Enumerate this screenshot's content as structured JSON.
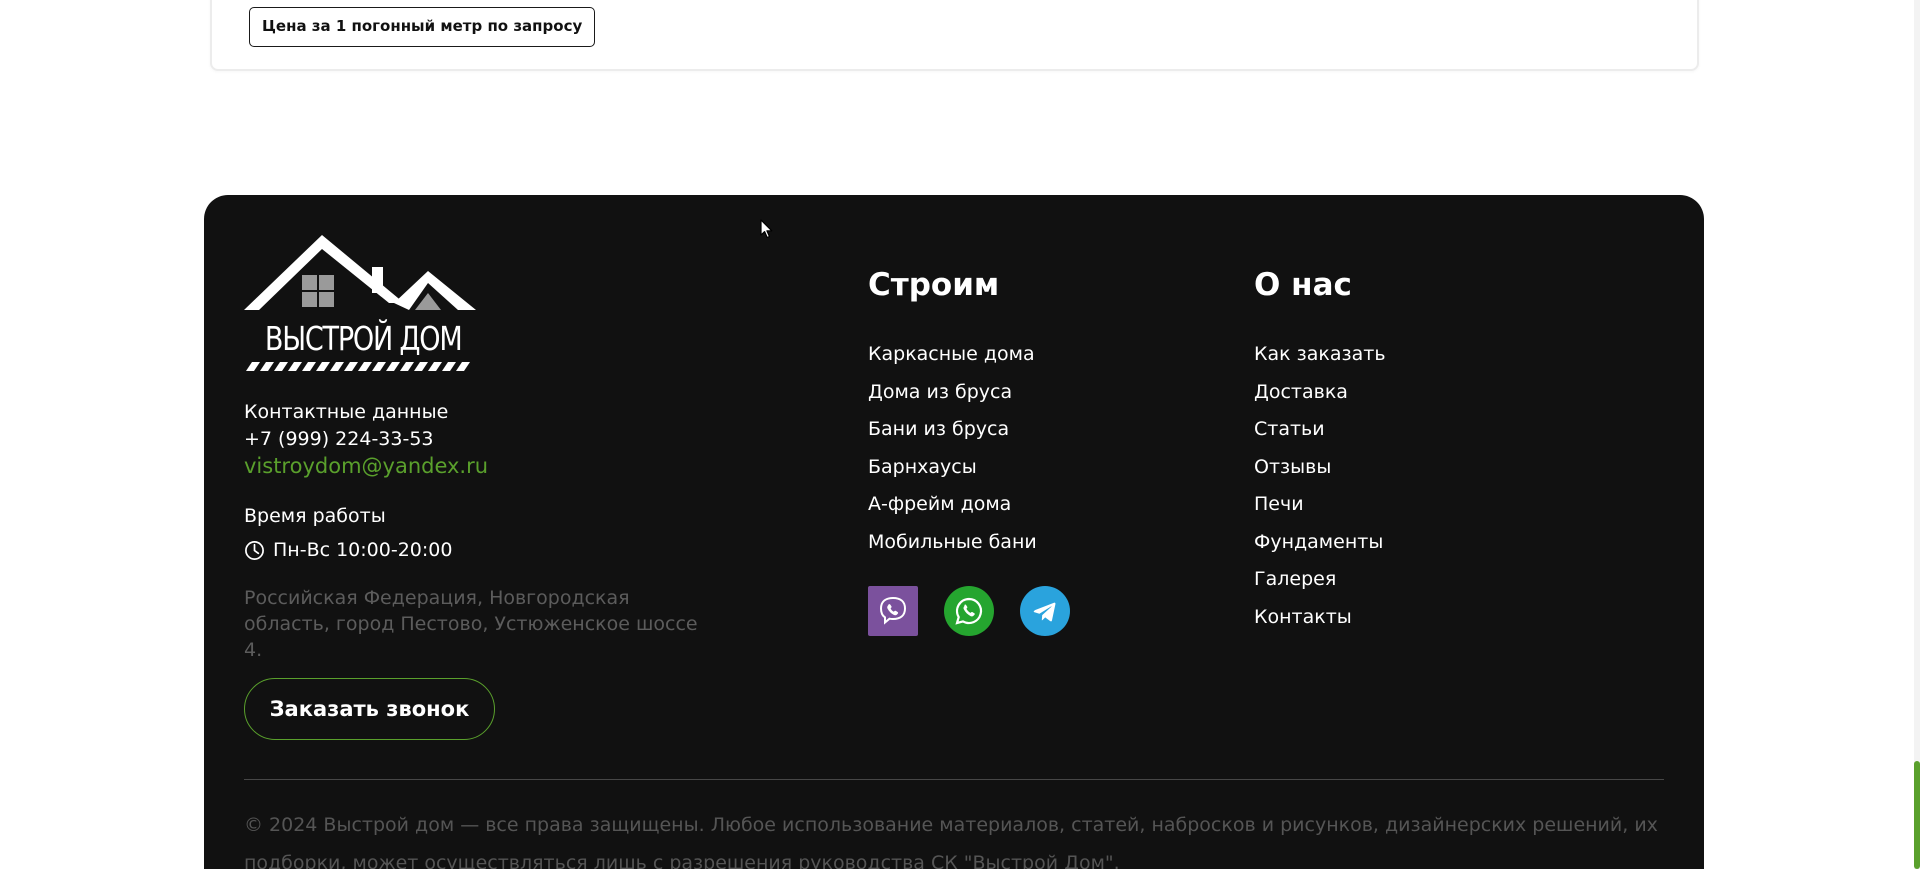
{
  "product_card": {
    "price_note": "Цена за 1 погонный метр по запросу"
  },
  "footer": {
    "logo": {
      "text": "ВЫСТРОЙ ДОМ",
      "icon": "house-roof-logo"
    },
    "contacts": {
      "title": "Контактные данные",
      "phone": "+7 (999) 224-33-53",
      "email": "vistroydom@yandex.ru"
    },
    "hours": {
      "title": "Время работы",
      "icon": "clock-icon",
      "value": "Пн-Вс 10:00-20:00"
    },
    "address": "Российская Федерация, Новгородская область, город Пестово, Устюженское шоссе 4.",
    "callback_button": "Заказать звонок",
    "build_column": {
      "title": "Строим",
      "items": [
        "Каркасные дома",
        "Дома из бруса",
        "Бани из бруса",
        "Барнхаусы",
        "А-фрейм дома",
        "Мобильные бани"
      ]
    },
    "socials": [
      {
        "name": "viber",
        "icon": "viber-icon",
        "color": "#7b519d"
      },
      {
        "name": "whatsapp",
        "icon": "whatsapp-icon",
        "color": "#25a52f"
      },
      {
        "name": "telegram",
        "icon": "telegram-icon",
        "color": "#2aa3dd"
      }
    ],
    "about_column": {
      "title": "О нас",
      "items": [
        "Как заказать",
        "Доставка",
        "Статьи",
        "Отзывы",
        "Печи",
        "Фундаменты",
        "Галерея",
        "Контакты"
      ]
    },
    "copyright": "© 2024 Выстрой дом — все права защищены. Любое использование материалов, статей, набросков и рисунков, дизайнерских решений, их подборки, может осуществляться лишь с разрешения руководства СК \"Выстрой Дом\"."
  },
  "colors": {
    "accent": "#5aa02c",
    "footer_bg": "#111111",
    "muted_text": "#5c5c5c"
  }
}
